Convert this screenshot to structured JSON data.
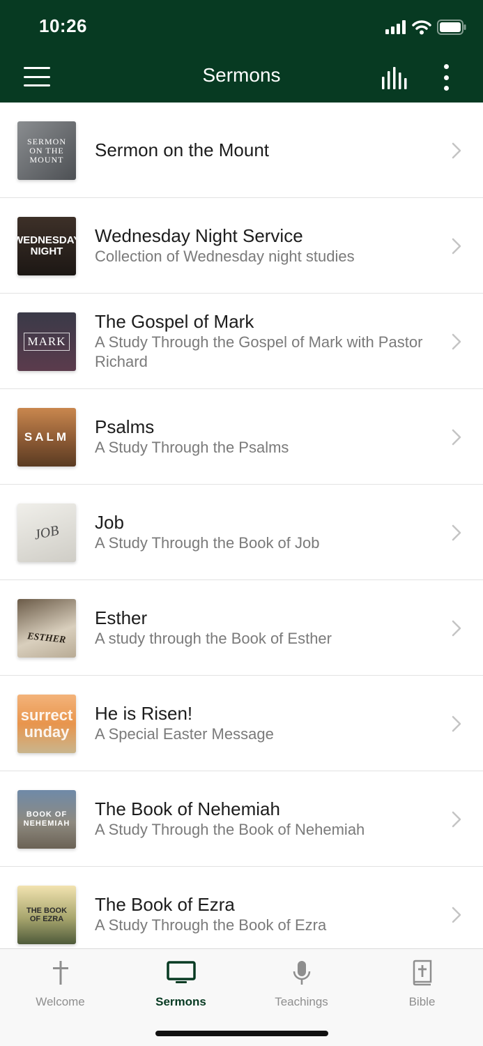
{
  "status": {
    "time": "10:26"
  },
  "header": {
    "title": "Sermons"
  },
  "colors": {
    "primary": "#073a22",
    "text": "#1c1c1c",
    "subtext": "#7a7a7a"
  },
  "icons": {
    "menu": "hamburger-icon",
    "chart": "equalizer-icon",
    "more": "more-vertical-icon",
    "row": "chevron-right-icon"
  },
  "sermons": [
    {
      "title": "Sermon on the Mount",
      "subtitle": "",
      "art_text": "SERMON ON THE MOUNT"
    },
    {
      "title": "Wednesday Night Service",
      "subtitle": "Collection of Wednesday night studies",
      "art_text": "WEDNESDAY NIGHT"
    },
    {
      "title": "The Gospel of Mark",
      "subtitle": "A Study Through the Gospel of Mark with Pastor Richard",
      "art_text": "MARK"
    },
    {
      "title": "Psalms",
      "subtitle": "A Study Through the Psalms",
      "art_text": "SALM"
    },
    {
      "title": "Job",
      "subtitle": "A Study Through the Book of Job",
      "art_text": "JOB"
    },
    {
      "title": "Esther",
      "subtitle": "A study through the Book of Esther",
      "art_text": "ESTHER"
    },
    {
      "title": "He is Risen!",
      "subtitle": "A Special Easter Message",
      "art_text": "surrect unday"
    },
    {
      "title": "The Book of Nehemiah",
      "subtitle": "A Study Through the Book of Nehemiah",
      "art_text": "BOOK OF NEHEMIAH"
    },
    {
      "title": "The Book of Ezra",
      "subtitle": "A Study Through the Book of Ezra",
      "art_text": "THE BOOK OF EZRA"
    }
  ],
  "tabs": [
    {
      "label": "Welcome",
      "icon": "cross-icon",
      "active": false
    },
    {
      "label": "Sermons",
      "icon": "tv-icon",
      "active": true
    },
    {
      "label": "Teachings",
      "icon": "microphone-icon",
      "active": false
    },
    {
      "label": "Bible",
      "icon": "bible-icon",
      "active": false
    }
  ]
}
